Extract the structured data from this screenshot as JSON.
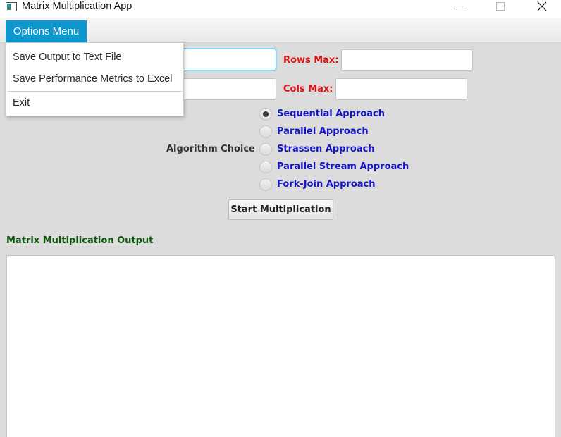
{
  "window": {
    "title": "Matrix Multiplication App"
  },
  "menubar": {
    "options_label": "Options Menu"
  },
  "options_menu": {
    "items": [
      {
        "label": "Save Output to Text File"
      },
      {
        "label": "Save Performance Metrics to Excel"
      },
      {
        "label": "Exit"
      }
    ]
  },
  "form": {
    "rows_max_label": "Rows Max:",
    "cols_max_label": "Cols Max:",
    "rows_min_value": "",
    "rows_max_value": "",
    "cols_min_value": "",
    "cols_max_value": ""
  },
  "algorithm": {
    "label": "Algorithm Choice",
    "selected": "Sequential Approach",
    "options": [
      {
        "label": "Sequential Approach"
      },
      {
        "label": "Parallel Approach"
      },
      {
        "label": "Strassen Approach"
      },
      {
        "label": "Parallel Stream Approach"
      },
      {
        "label": "Fork-Join Approach"
      }
    ]
  },
  "actions": {
    "start_label": "Start Multiplication"
  },
  "output": {
    "label": "Matrix Multiplication Output",
    "text": ""
  },
  "colors": {
    "menu_accent": "#0e96cf",
    "label_red": "#e01010",
    "radio_label_blue": "#1515c8",
    "output_label_green": "#0a5a0a"
  },
  "icons": {
    "app": "app-window-icon",
    "minimize": "minimize-icon",
    "maximize": "maximize-icon",
    "close": "close-icon"
  }
}
